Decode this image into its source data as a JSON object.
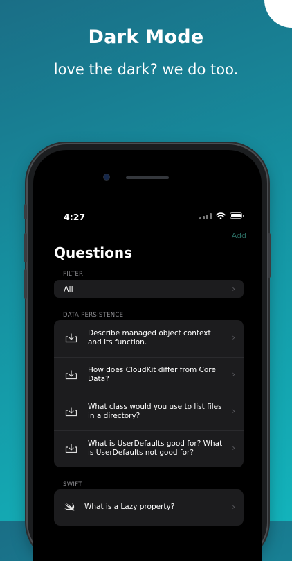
{
  "promo": {
    "title": "Dark Mode",
    "subtitle": "love the dark? we do too."
  },
  "status_bar": {
    "time": "4:27"
  },
  "nav": {
    "add_label": "Add",
    "title": "Questions"
  },
  "filter": {
    "section_label": "FILTER",
    "value": "All"
  },
  "sections": [
    {
      "label": "DATA PERSISTENCE",
      "items": [
        {
          "text": "Describe managed object context and its function.",
          "icon": "tray-download-icon"
        },
        {
          "text": "How does CloudKit differ from Core Data?",
          "icon": "tray-download-icon"
        },
        {
          "text": "What class would you use to list files in a directory?",
          "icon": "tray-download-icon"
        },
        {
          "text": "What is UserDefaults good for? What is UserDefaults not good for?",
          "icon": "tray-download-icon"
        }
      ]
    },
    {
      "label": "SWIFT",
      "items": [
        {
          "text": "What is a Lazy property?",
          "icon": "swift-logo-icon"
        }
      ]
    }
  ],
  "colors": {
    "background_start": "#1a6e86",
    "background_end": "#13b3bb",
    "accent": "#2a6a60",
    "cell": "#1c1c1e",
    "secondary_text": "#8a8a8e"
  }
}
